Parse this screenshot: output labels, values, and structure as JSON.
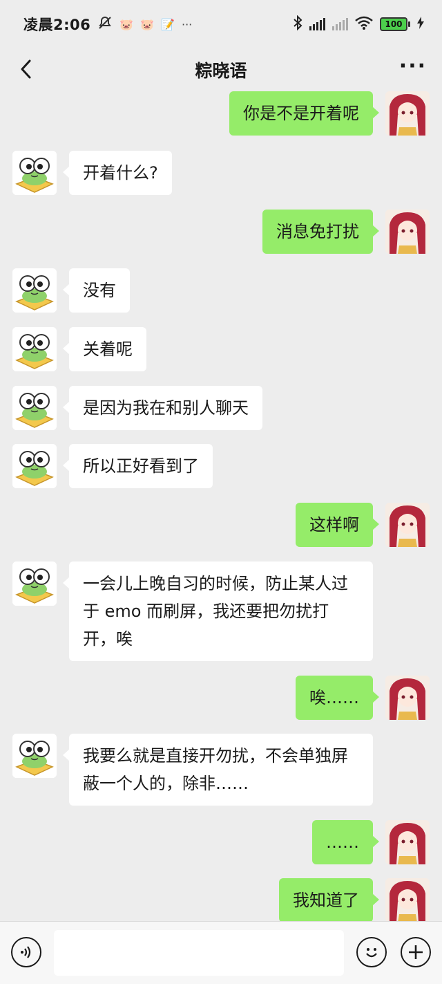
{
  "status_bar": {
    "time": "凌晨2:06",
    "icons": [
      "mute-icon",
      "app-icon-pig",
      "app-icon-pig-2",
      "app-icon-note",
      "more-dots"
    ],
    "more_dots": "···",
    "battery_level": "100"
  },
  "nav": {
    "title": "粽晓语",
    "more": "···"
  },
  "messages": [
    {
      "side": "out",
      "text": "你是不是开着呢"
    },
    {
      "side": "in",
      "text": "开着什么?"
    },
    {
      "side": "out",
      "text": "消息免打扰"
    },
    {
      "side": "in",
      "text": "没有"
    },
    {
      "side": "in",
      "text": "关着呢"
    },
    {
      "side": "in",
      "text": "是因为我在和别人聊天"
    },
    {
      "side": "in",
      "text": "所以正好看到了"
    },
    {
      "side": "out",
      "text": "这样啊"
    },
    {
      "side": "in",
      "text": "一会儿上晚自习的时候，防止某人过于 emo 而刷屏，我还要把勿扰打开，唉"
    },
    {
      "side": "out",
      "text": "唉……"
    },
    {
      "side": "in",
      "text": "我要么就是直接开勿扰，不会单独屏蔽一个人的，除非……"
    },
    {
      "side": "out",
      "text": "……"
    },
    {
      "side": "out",
      "text": "我知道了"
    }
  ],
  "input": {
    "placeholder": ""
  },
  "colors": {
    "bubble_out": "#95ec69",
    "bubble_in": "#ffffff",
    "background": "#ededed"
  }
}
